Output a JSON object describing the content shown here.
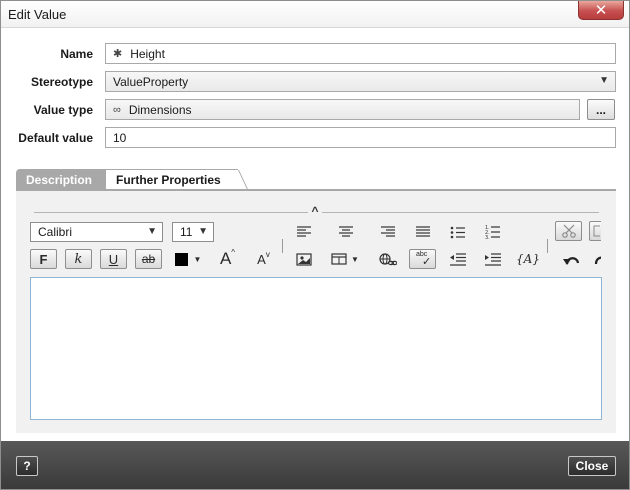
{
  "window": {
    "title": "Edit Value",
    "close_glyph": "✕"
  },
  "form": {
    "name_label": "Name",
    "name_value": "Height",
    "name_glyph": "✱",
    "stereotype_label": "Stereotype",
    "stereotype_value": "ValueProperty",
    "value_type_label": "Value type",
    "value_type_value": "Dimensions",
    "value_type_glyph": "∞",
    "browse_label": "...",
    "default_label": "Default value",
    "default_value": "10"
  },
  "tabs": [
    {
      "label": "Description",
      "active": true
    },
    {
      "label": "Further Properties",
      "active": false
    }
  ],
  "editor": {
    "font_family": "Calibri",
    "font_size": "11",
    "bold_glyph": "F",
    "italic_glyph": "k",
    "underline_glyph": "U",
    "strike_glyph": "ab",
    "text_color": "#000000",
    "grow_glyph": "A",
    "shrink_glyph": "A",
    "insert_field_glyph": "{A}",
    "spell_glyph": "abc",
    "icons": [
      "collapse-caret-icon",
      "align-left-icon",
      "align-center-icon",
      "align-right-icon",
      "justify-icon",
      "bullet-list-icon",
      "numbered-list-icon",
      "cut-icon",
      "copy-icon",
      "font-grow-icon",
      "font-shrink-icon",
      "insert-image-icon",
      "insert-table-icon",
      "hyperlink-icon",
      "spellcheck-icon",
      "outdent-icon",
      "indent-icon",
      "insert-field-icon",
      "undo-icon",
      "redo-icon"
    ],
    "content": ""
  },
  "footer": {
    "help_label": "?",
    "close_label": "Close"
  },
  "colors": {
    "accent_tab": "#a8a8a8",
    "footer_bg": "#484848",
    "close_button": "#c75050",
    "editor_border": "#8fb5d6"
  }
}
